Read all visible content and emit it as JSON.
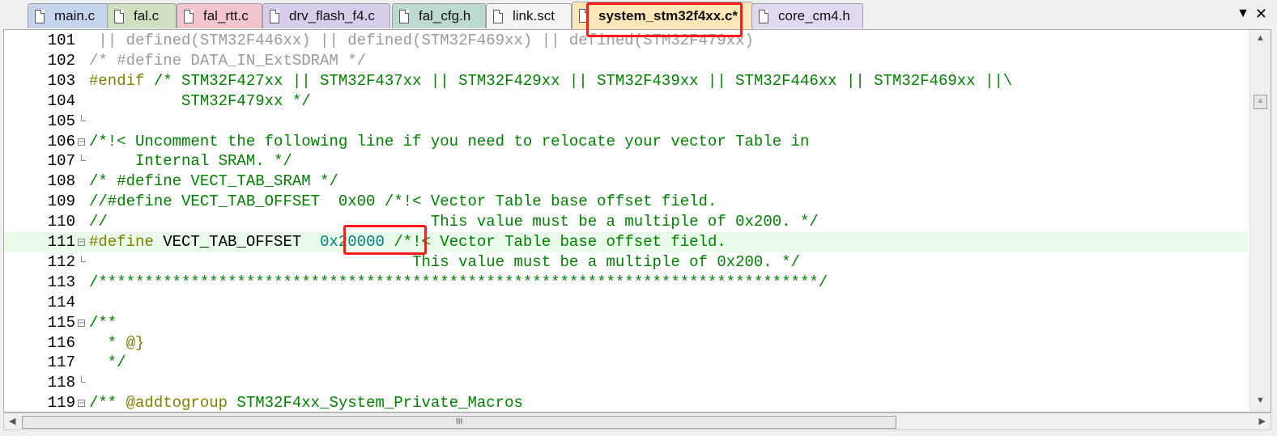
{
  "tabs": [
    {
      "label": "main.c",
      "color": "#c7d4ee"
    },
    {
      "label": "fal.c",
      "color": "#cfe0c0"
    },
    {
      "label": "fal_rtt.c",
      "color": "#f2c6cc"
    },
    {
      "label": "drv_flash_f4.c",
      "color": "#d8cdeb"
    },
    {
      "label": "fal_cfg.h",
      "color": "#bcd9d2"
    },
    {
      "label": "link.sct",
      "color": "#f4f4f4"
    },
    {
      "label": "system_stm32f4xx.c*",
      "color": "#fde6b8",
      "active": true
    },
    {
      "label": "core_cm4.h",
      "color": "#e2d8f0"
    }
  ],
  "tabbar": {
    "menu_glyph": "▼",
    "close_glyph": "✕"
  },
  "lines": [
    {
      "n": "101",
      "tokens": [
        {
          "t": " || defined(STM32F446xx) || defined(STM32F469xx) || defined(STM32F479xx)",
          "c": "gray"
        }
      ]
    },
    {
      "n": "102",
      "tokens": [
        {
          "t": "/* #define DATA_IN_ExtSDRAM */",
          "c": "gray"
        }
      ]
    },
    {
      "n": "103",
      "tokens": [
        {
          "t": "#endif",
          "c": "pp"
        },
        {
          "t": " /* STM32F427xx || STM32F437xx || STM32F429xx || STM32F439xx || STM32F446xx || STM32F469xx ||\\",
          "c": "cmt"
        }
      ]
    },
    {
      "n": "104",
      "tokens": [
        {
          "t": "          STM32F479xx */",
          "c": "cmt"
        }
      ]
    },
    {
      "n": "105",
      "tokens": [],
      "fold": "end"
    },
    {
      "n": "106",
      "tokens": [
        {
          "t": "/*!< Uncomment the following line if you need to relocate your vector Table in",
          "c": "cmt"
        }
      ],
      "fold": "box"
    },
    {
      "n": "107",
      "tokens": [
        {
          "t": "     Internal SRAM. */",
          "c": "cmt"
        }
      ],
      "fold": "end"
    },
    {
      "n": "108",
      "tokens": [
        {
          "t": "/* #define VECT_TAB_SRAM */",
          "c": "cmt"
        }
      ]
    },
    {
      "n": "109",
      "tokens": [
        {
          "t": "//#define VECT_TAB_OFFSET  0x00 /*!< Vector Table base offset field.",
          "c": "cmt"
        }
      ]
    },
    {
      "n": "110",
      "tokens": [
        {
          "t": "//                                   This value must be a multiple of 0x200. */",
          "c": "cmt"
        }
      ]
    },
    {
      "n": "111",
      "tokens": [
        {
          "t": "#define",
          "c": "pp"
        },
        {
          "t": " VECT_TAB_OFFSET  ",
          "c": "pl"
        },
        {
          "t": "0x20000",
          "c": "num"
        },
        {
          "t": " /*!< Vector Table base offset field.",
          "c": "cmt"
        }
      ],
      "fold": "box",
      "highlight": true
    },
    {
      "n": "112",
      "tokens": [
        {
          "t": "                                   This value must be a multiple of 0x200. */",
          "c": "cmt"
        }
      ],
      "fold": "end"
    },
    {
      "n": "113",
      "tokens": [
        {
          "t": "/******************************************************************************/",
          "c": "cmt"
        }
      ]
    },
    {
      "n": "114",
      "tokens": []
    },
    {
      "n": "115",
      "tokens": [
        {
          "t": "/**",
          "c": "cmt"
        }
      ],
      "fold": "box"
    },
    {
      "n": "116",
      "tokens": [
        {
          "t": "  * ",
          "c": "cmt"
        },
        {
          "t": "@}",
          "c": "pp"
        }
      ]
    },
    {
      "n": "117",
      "tokens": [
        {
          "t": "  */",
          "c": "cmt"
        }
      ]
    },
    {
      "n": "118",
      "tokens": [],
      "fold": "end"
    },
    {
      "n": "119",
      "tokens": [
        {
          "t": "/** ",
          "c": "cmt"
        },
        {
          "t": "@addtogroup",
          "c": "pp"
        },
        {
          "t": " STM32F4xx_System_Private_Macros",
          "c": "cmt"
        }
      ],
      "fold": "box"
    }
  ],
  "scroll": {
    "grip": "III",
    "grip_v": "≡",
    "left_arrow": "◀",
    "right_arrow": "▶",
    "up_arrow": "▲",
    "down_arrow": "▼"
  }
}
